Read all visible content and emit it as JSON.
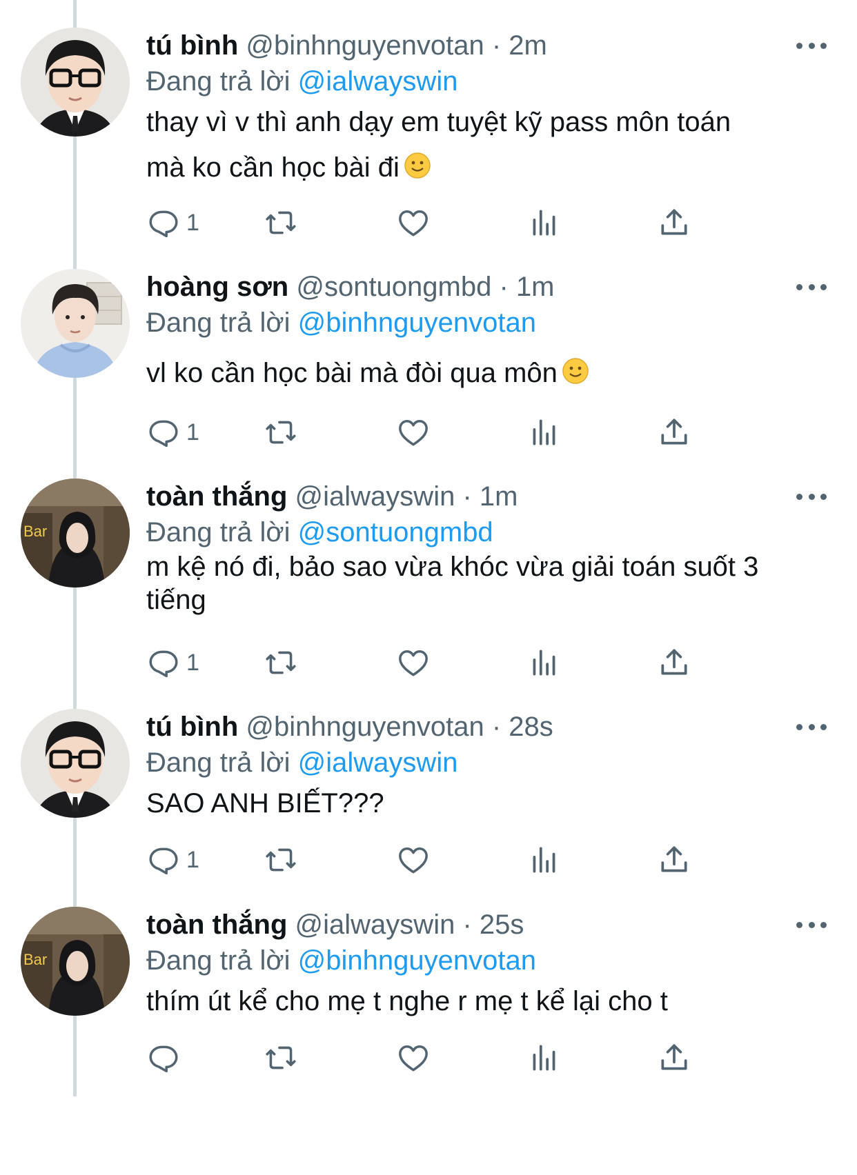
{
  "tweets": [
    {
      "name": "tú bình",
      "handle": "@binhnguyenvotan",
      "dot": "·",
      "time": "2m",
      "reply_prefix": "Đang trả lời",
      "reply_to": "@ialwayswin",
      "text": "thay vì v thì anh dạy em tuyệt kỹ pass môn toán\nmà ko cần học bài đi",
      "has_emoji": true,
      "reply_count": "1",
      "avatar": "avatar-glasses"
    },
    {
      "name": "hoàng sơn",
      "handle": "@sontuongmbd",
      "dot": "·",
      "time": "1m",
      "reply_prefix": "Đang trả lời",
      "reply_to": "@binhnguyenvotan",
      "text": "vl ko cần học bài mà đòi qua môn",
      "has_emoji": true,
      "reply_count": "1",
      "avatar": "avatar-hoodie"
    },
    {
      "name": "toàn thắng",
      "handle": "@ialwayswin",
      "dot": "·",
      "time": "1m",
      "reply_prefix": "Đang trả lời",
      "reply_to": "@sontuongmbd",
      "text": "m kệ nó đi, bảo sao vừa khóc vừa giải toán suốt 3\ntiếng",
      "has_emoji": false,
      "reply_count": "1",
      "avatar": "avatar-bar"
    },
    {
      "name": "tú bình",
      "handle": "@binhnguyenvotan",
      "dot": "·",
      "time": "28s",
      "reply_prefix": "Đang trả lời",
      "reply_to": "@ialwayswin",
      "text": "SAO ANH BIẾT???",
      "has_emoji": false,
      "reply_count": "1",
      "avatar": "avatar-glasses"
    },
    {
      "name": "toàn thắng",
      "handle": "@ialwayswin",
      "dot": "·",
      "time": "25s",
      "reply_prefix": "Đang trả lời",
      "reply_to": "@binhnguyenvotan",
      "text": "thím út kể cho mẹ t nghe r mẹ t kể lại cho t",
      "has_emoji": false,
      "reply_count": "",
      "avatar": "avatar-bar"
    }
  ],
  "avatar_bar_sign": "Bar",
  "icons": {
    "reply": "reply-icon",
    "retweet": "retweet-icon",
    "like": "heart-icon",
    "views": "views-icon",
    "share": "share-icon",
    "more": "more-icon",
    "emoji": "slightly-smiling-face-emoji"
  },
  "colors": {
    "mention": "#1d9bf0",
    "secondary_text": "#536471",
    "primary_text": "#0f1419",
    "thread_line": "#cfd9de"
  }
}
